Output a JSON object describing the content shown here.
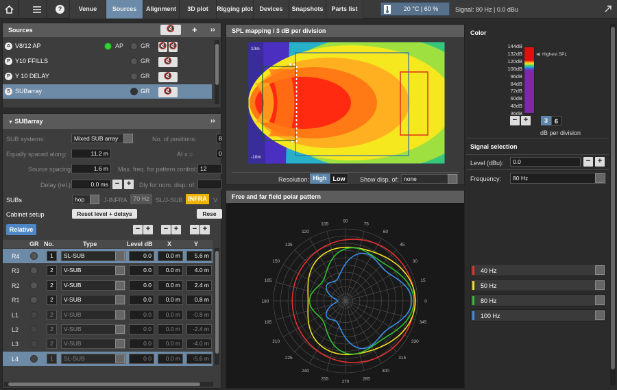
{
  "topbar": {
    "tabs": [
      "Venue",
      "Sources",
      "Alignment",
      "3D plot",
      "Rigging plot",
      "Devices",
      "Snapshots",
      "Parts list"
    ],
    "active_tab": "Sources",
    "env": "20 °C | 60 %",
    "signal": "Signal: 80 Hz | 0.0 dBu"
  },
  "sources": {
    "title": "Sources",
    "items": [
      {
        "icon": "A",
        "name": "V8/12 AP",
        "ap": "AP",
        "gr": "GR"
      },
      {
        "icon": "P",
        "name": "Y10 FFILLS",
        "gr": "GR"
      },
      {
        "icon": "P",
        "name": "Y 10 DELAY",
        "gr": "GR"
      },
      {
        "icon": "S",
        "name": "SUBarray",
        "gr": "GR"
      }
    ]
  },
  "sub": {
    "title": "SUBarray",
    "sub_systems_label": "SUB systems:",
    "sub_systems": "Mixed SUB array",
    "positions_label": "No. of positions:",
    "positions": "8",
    "equal_label": "Equally spaced along:",
    "equal": "11.2 m",
    "at_label": "At x =",
    "at_value": "0",
    "spacing_label": "Source spacing:",
    "spacing": "1.6 m",
    "maxfreq_label": "Max. freq. for pattern control:",
    "maxfreq": "12",
    "delay_label": "Delay (rel.):",
    "delay": "0.0 ms",
    "dly_label": "Dly for nom. disp. of:",
    "subs_label": "SUBs",
    "subs_mode": "hop",
    "jinfra": "J-INFRA",
    "hz70": "70 Hz",
    "sljsub": "SL/J-SUB",
    "infra": "INFRA",
    "vtag": "V",
    "cabinet_label": "Cabinet setup",
    "reset_btn": "Reset level + delays",
    "rese_btn": "Rese",
    "relative": "Relative",
    "cols": [
      "GR",
      "No.",
      "Type",
      "Level dB",
      "X",
      "Y"
    ],
    "rows": [
      {
        "id": "R4",
        "no": "1",
        "type": "SL-SUB",
        "level": "0.0",
        "x": "0.0 m",
        "y": "5.6 m",
        "sel": true,
        "dim": false
      },
      {
        "id": "R3",
        "no": "2",
        "type": "V-SUB",
        "level": "0.0",
        "x": "0.0 m",
        "y": "4.0 m",
        "sel": false,
        "dim": false
      },
      {
        "id": "R2",
        "no": "2",
        "type": "V-SUB",
        "level": "0.0",
        "x": "0.0 m",
        "y": "2.4 m",
        "sel": false,
        "dim": false
      },
      {
        "id": "R1",
        "no": "2",
        "type": "V-SUB",
        "level": "0.0",
        "x": "0.0 m",
        "y": "0.8 m",
        "sel": false,
        "dim": false
      },
      {
        "id": "L1",
        "no": "2",
        "type": "V-SUB",
        "level": "0.0",
        "x": "0.0 m",
        "y": "-0.8 m",
        "sel": false,
        "dim": true
      },
      {
        "id": "L2",
        "no": "2",
        "type": "V-SUB",
        "level": "0.0",
        "x": "0.0 m",
        "y": "-2.4 m",
        "sel": false,
        "dim": true
      },
      {
        "id": "L3",
        "no": "2",
        "type": "V-SUB",
        "level": "0.0",
        "x": "0.0 m",
        "y": "-4.0 m",
        "sel": false,
        "dim": true
      },
      {
        "id": "L4",
        "no": "1",
        "type": "SL-SUB",
        "level": "0.0",
        "x": "0.0 m",
        "y": "-5.6 m",
        "sel": true,
        "dim": true
      }
    ]
  },
  "spl": {
    "title": "SPL mapping / 3 dB per division",
    "label_top": "10m",
    "label_bottom": "-10m",
    "resolution_label": "Resolution:",
    "high": "High",
    "low": "Low",
    "show_label": "Show disp. of:",
    "show_value": "none"
  },
  "polar": {
    "title": "Free and far field polar pattern",
    "angles": [
      "0",
      "15",
      "30",
      "45",
      "60",
      "75",
      "90",
      "105",
      "120",
      "135",
      "150",
      "165",
      "180",
      "195",
      "210",
      "225",
      "240",
      "255",
      "270",
      "285",
      "300",
      "315",
      "330",
      "345"
    ]
  },
  "color": {
    "title": "Color",
    "scale": [
      "144dB",
      "132dB",
      "120dB",
      "108dB",
      "96dB",
      "84dB",
      "72dB",
      "60dB",
      "48dB",
      "36dB"
    ],
    "highest": "Highest SPL",
    "div3": "3",
    "div6": "6",
    "per_div": "dB per division"
  },
  "signal": {
    "title": "Signal selection",
    "level_label": "Level (dBu):",
    "level": "0.0",
    "freq_label": "Frequency:",
    "freq": "80 Hz"
  },
  "legend": [
    {
      "label": "40 Hz",
      "color": "#e53030"
    },
    {
      "label": "50 Hz",
      "color": "#f0e020"
    },
    {
      "label": "80 Hz",
      "color": "#30c030"
    },
    {
      "label": "100 Hz",
      "color": "#3a8ee8"
    }
  ]
}
